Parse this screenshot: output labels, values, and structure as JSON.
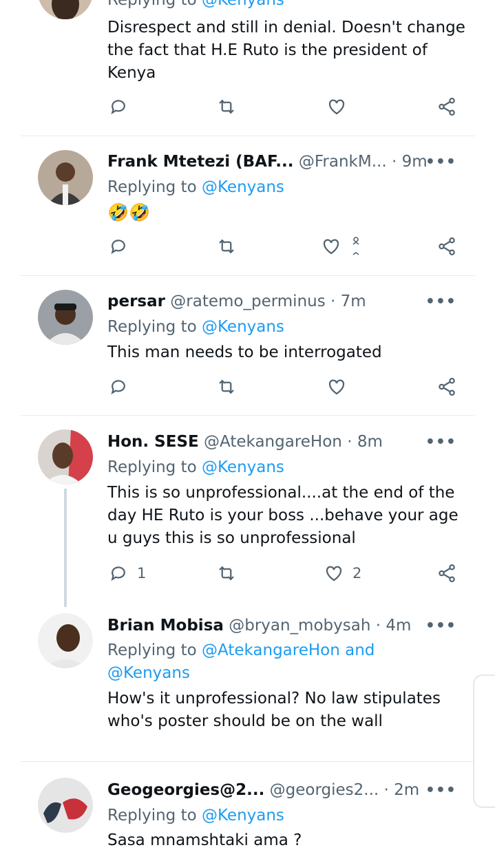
{
  "tweets": [
    {
      "reply_prefix": "Replying to",
      "reply_to": "@Kenyans",
      "text": "Disrespect and still in denial. Doesn't change the fact that H.E Ruto is the president of Kenya"
    },
    {
      "name": "Frank Mtetezi (BAF...",
      "handle": "@FrankM...",
      "time": "9m",
      "reply_prefix": "Replying to",
      "reply_to": "@Kenyans",
      "text": "🤣🤣"
    },
    {
      "name": "persar",
      "handle": "@ratemo_perminus",
      "time": "7m",
      "reply_prefix": "Replying to",
      "reply_to": "@Kenyans",
      "text": "This man needs to be interrogated"
    },
    {
      "name": "Hon. SESE",
      "handle": "@AtekangareHon",
      "time": "8m",
      "reply_prefix": "Replying to",
      "reply_to": "@Kenyans",
      "text": "This is so unprofessional....at the end of the day HE Ruto is your boss ...behave your age u guys this is so unprofessional",
      "reply_count": "1",
      "like_count": "2"
    },
    {
      "name": "Brian Mobisa",
      "handle": "@bryan_mobysah",
      "time": "4m",
      "reply_prefix": "Replying to",
      "reply_to": "@AtekangareHon and @Kenyans",
      "text": "How's it unprofessional? No law stipulates who's poster should be on the wall"
    },
    {
      "name": "Geogeorgies@2...",
      "handle": "@georgies2...",
      "time": "2m",
      "reply_prefix": "Replying to",
      "reply_to": "@Kenyans",
      "text": "Sasa mnamshtaki ama ?"
    }
  ],
  "ui": {
    "dot": "·",
    "more": "•••"
  },
  "colors": {
    "accent": "#1d9bf0",
    "muted": "#536471",
    "text": "#0f1419",
    "divider": "#e6ecf0"
  },
  "icons": [
    "reply-icon",
    "retweet-icon",
    "like-icon",
    "share-icon",
    "more-icon"
  ]
}
